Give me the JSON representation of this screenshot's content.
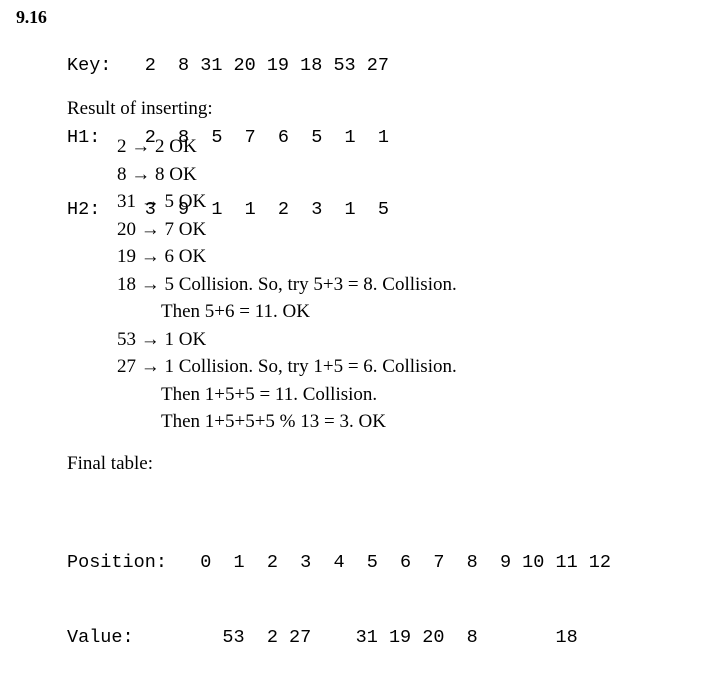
{
  "problem": {
    "number": "9.16"
  },
  "hash_header": {
    "rows": [
      {
        "label": "Key:",
        "values": [
          "2",
          "8",
          "31",
          "20",
          "19",
          "18",
          "53",
          "27"
        ]
      },
      {
        "label": "H1:",
        "values": [
          "2",
          "8",
          "5",
          "7",
          "6",
          "5",
          "1",
          "1"
        ]
      },
      {
        "label": "H2:",
        "values": [
          "3",
          "9",
          "1",
          "1",
          "2",
          "3",
          "1",
          "5"
        ]
      }
    ]
  },
  "labels": {
    "result_of_inserting": "Result of inserting:",
    "final_table": "Final table:"
  },
  "arrow_glyph": "→",
  "insertion_trace": [
    {
      "indent": false,
      "text": "2 → 2 OK"
    },
    {
      "indent": false,
      "text": "8 → 8 OK"
    },
    {
      "indent": false,
      "text": "31 → 5 OK"
    },
    {
      "indent": false,
      "text": "20 → 7 OK"
    },
    {
      "indent": false,
      "text": "19 → 6 OK"
    },
    {
      "indent": false,
      "text": "18 → 5 Collision. So, try 5+3 = 8. Collision."
    },
    {
      "indent": true,
      "text": "Then 5+6 = 11. OK"
    },
    {
      "indent": false,
      "text": "53 → 1 OK"
    },
    {
      "indent": false,
      "text": "27 → 1 Collision. So, try 1+5 = 6. Collision."
    },
    {
      "indent": true,
      "text": "Then 1+5+5 = 11. Collision."
    },
    {
      "indent": true,
      "text": "Then 1+5+5+5 % 13 = 3. OK"
    }
  ],
  "final_table": {
    "position_label": "Position:",
    "value_label": "Value:",
    "positions": [
      "0",
      "1",
      "2",
      "3",
      "4",
      "5",
      "6",
      "7",
      "8",
      "9",
      "10",
      "11",
      "12"
    ],
    "values": [
      "",
      "53",
      "2",
      "27",
      "",
      "31",
      "19",
      "20",
      "8",
      "",
      "",
      "18",
      ""
    ]
  },
  "colors": {
    "background": "#ffffff",
    "text": "#000000"
  }
}
